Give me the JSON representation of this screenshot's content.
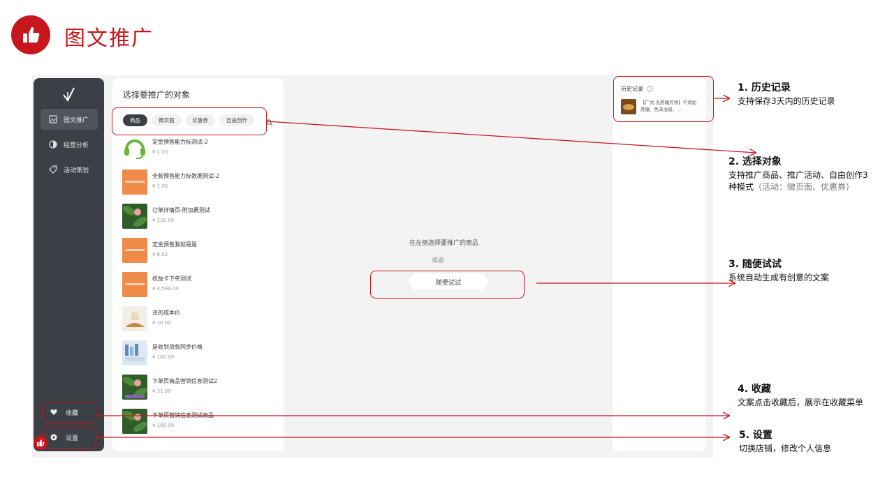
{
  "header": {
    "title": "图文推广",
    "logo_icon": "thumbs-up-icon"
  },
  "sidebar": {
    "logo_icon": "checkmark-logo-icon",
    "items": [
      {
        "label": "图文推广",
        "icon": "image-text-icon",
        "active": true
      },
      {
        "label": "经营分析",
        "icon": "pie-chart-icon",
        "active": false
      },
      {
        "label": "活动策划",
        "icon": "tag-icon",
        "active": false
      }
    ],
    "bottom": [
      {
        "label": "收藏",
        "icon": "heart-icon"
      },
      {
        "label": "设置",
        "icon": "settings-icon"
      }
    ]
  },
  "list_panel": {
    "title": "选择要推广的对象",
    "tabs": [
      {
        "label": "商品",
        "active": true
      },
      {
        "label": "微页面",
        "active": false
      },
      {
        "label": "优惠券",
        "active": false
      },
      {
        "label": "自由创作",
        "active": false
      }
    ],
    "products": [
      {
        "name": "定金预售能力标测试-2",
        "price": "¥ 1.00",
        "thumb": "headset"
      },
      {
        "name": "全款预售能力标数据测试-2",
        "price": "¥ 1.00",
        "thumb": "orange"
      },
      {
        "name": "订单详情页-附加费测试",
        "price": "¥ 120.00",
        "thumb": "leaf"
      },
      {
        "name": "定金预售我就是是",
        "price": "¥ 0.02",
        "thumb": "orange"
      },
      {
        "name": "权益卡下单测试",
        "price": "¥ 4,599.00",
        "thumb": "orange"
      },
      {
        "name": "泽的成本价",
        "price": "¥ 10.00",
        "thumb": "tea"
      },
      {
        "name": "是收到货款同步价格",
        "price": "¥ 100.00",
        "thumb": "bath"
      },
      {
        "name": "下单页商品营销信息测试2",
        "price": "¥ 31.00",
        "thumb": "leaf"
      },
      {
        "name": "下单页营销信息测试商品",
        "price": "¥ 180.00",
        "thumb": "leaf"
      }
    ]
  },
  "center": {
    "hint": "在左侧选择要推广的商品",
    "or": "或者",
    "try_button": "随便试试"
  },
  "history": {
    "title": "历史记录",
    "items": [
      {
        "text": "【广式.无蔗糖月饼】不添加蔗糖、色泽油润、..."
      }
    ]
  },
  "annotations": [
    {
      "title": "1.  历史记录",
      "desc": "支持保存3天内的历史记录",
      "desc_muted": ""
    },
    {
      "title": "2. 选择对象",
      "desc": "支持推广商品、推广活动、自由创作3种模式",
      "desc_muted": "（活动：微页面、优惠券）"
    },
    {
      "title": "3. 随便试试",
      "desc": "系统自动生成有创意的文案",
      "desc_muted": ""
    },
    {
      "title": "4. 收藏",
      "desc": "文案点击收藏后，展示在收藏菜单",
      "desc_muted": ""
    },
    {
      "title": "5. 设置",
      "desc": "切换店铺，修改个人信息",
      "desc_muted": ""
    }
  ],
  "colors": {
    "accent": "#c8161d",
    "sidebar": "#3b3f46"
  }
}
